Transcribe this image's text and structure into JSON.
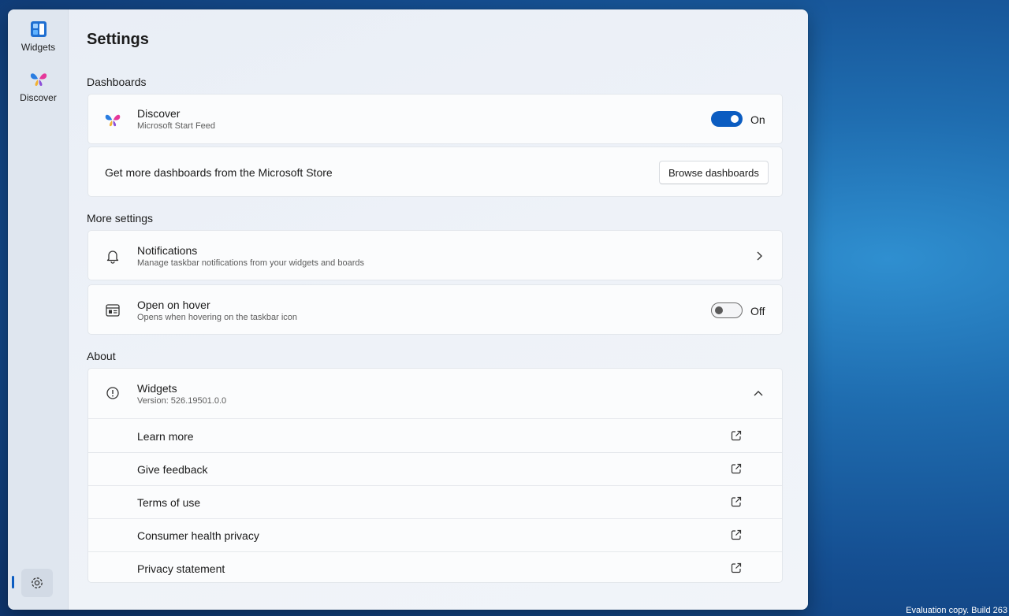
{
  "rail": {
    "widgets_label": "Widgets",
    "discover_label": "Discover"
  },
  "page": {
    "title": "Settings"
  },
  "dashboards": {
    "heading": "Dashboards",
    "discover": {
      "title": "Discover",
      "subtitle": "Microsoft Start Feed",
      "toggle_state": "On",
      "enabled": true
    },
    "store": {
      "text": "Get more dashboards from the Microsoft Store",
      "button_label": "Browse dashboards"
    }
  },
  "more_settings": {
    "heading": "More settings",
    "notifications": {
      "title": "Notifications",
      "subtitle": "Manage taskbar notifications from your widgets and boards"
    },
    "open_on_hover": {
      "title": "Open on hover",
      "subtitle": "Opens when hovering on the taskbar icon",
      "toggle_state": "Off",
      "enabled": false
    }
  },
  "about": {
    "heading": "About",
    "widgets": {
      "title": "Widgets",
      "subtitle": "Version: 526.19501.0.0"
    },
    "links": [
      {
        "label": "Learn more"
      },
      {
        "label": "Give feedback"
      },
      {
        "label": "Terms of use"
      },
      {
        "label": "Consumer health privacy"
      },
      {
        "label": "Privacy statement"
      }
    ]
  },
  "desktop": {
    "watermark": "Evaluation copy. Build 263"
  },
  "colors": {
    "accent": "#0b5cc1",
    "toggle_off_knob": "#5a5a5a"
  },
  "icons": {
    "widgets": "widgets-icon",
    "discover": "butterfly-icon",
    "settings": "gear-icon",
    "notifications": "bell-icon",
    "open_on_hover": "board-icon",
    "about": "info-icon",
    "chevron_right": "chevron-right-icon",
    "chevron_up": "chevron-up-icon",
    "external_link": "external-link-icon"
  }
}
